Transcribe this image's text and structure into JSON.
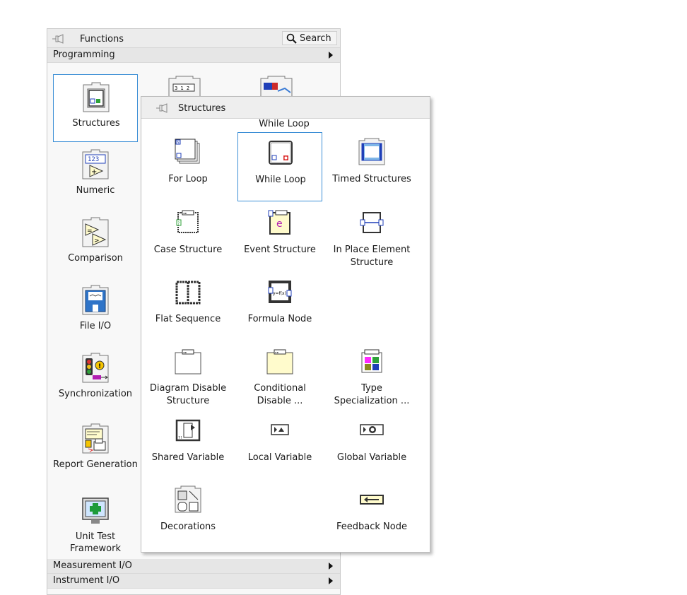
{
  "functions_palette": {
    "title": "Functions",
    "search_label": "Search",
    "categories": [
      {
        "label": "Programming"
      },
      {
        "label": "Measurement I/O"
      },
      {
        "label": "Instrument I/O"
      }
    ],
    "items": [
      {
        "label": "Structures"
      },
      {
        "label": "Numeric"
      },
      {
        "label": "Comparison"
      },
      {
        "label": "File I/O"
      },
      {
        "label": "Synchronization"
      },
      {
        "label": "Report Generation"
      },
      {
        "label": "Unit Test Framework"
      }
    ],
    "numeric_icon_text": "123"
  },
  "structures_palette": {
    "title": "Structures",
    "tooltip": "While Loop",
    "items": [
      {
        "label": "For Loop"
      },
      {
        "label": "While Loop"
      },
      {
        "label": "Timed Structures"
      },
      {
        "label": "Case Structure"
      },
      {
        "label": "Event Structure"
      },
      {
        "label": "In Place Element Structure"
      },
      {
        "label": "Flat Sequence"
      },
      {
        "label": "Formula Node"
      },
      {
        "label": "Diagram Disable Structure"
      },
      {
        "label": "Conditional Disable ..."
      },
      {
        "label": "Type Specialization ..."
      },
      {
        "label": "Shared Variable"
      },
      {
        "label": "Local Variable"
      },
      {
        "label": "Global Variable"
      },
      {
        "label": "Decorations"
      },
      {
        "label": "Feedback Node"
      }
    ],
    "formula_icon_text": "y=f(x)"
  },
  "colors": {
    "selection_border": "#3c8fd6",
    "header_bg": "#ececec",
    "palette_bg": "#f8f8f8"
  }
}
